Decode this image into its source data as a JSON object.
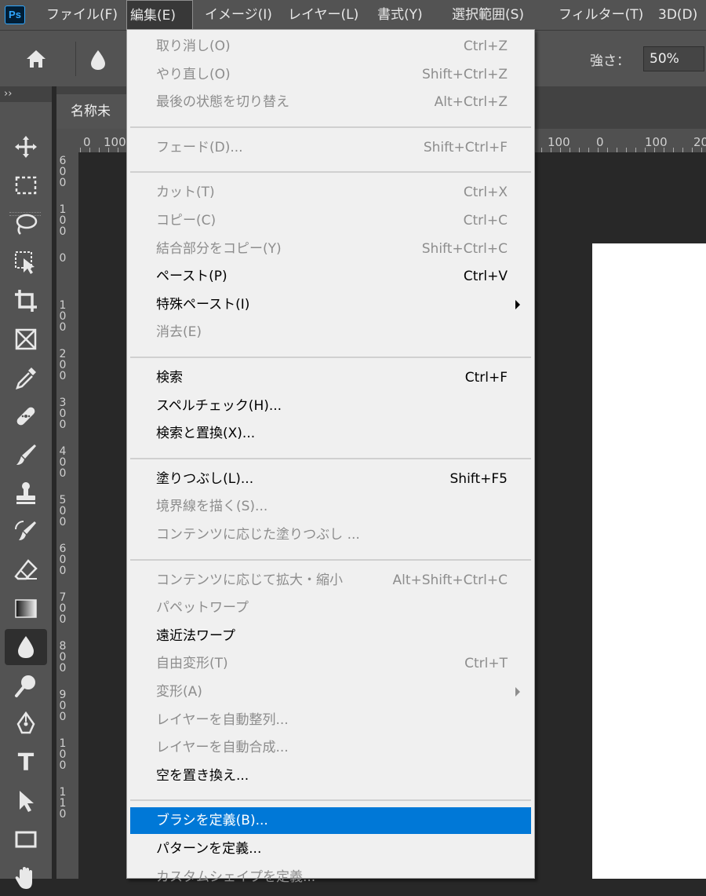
{
  "app": {
    "logo": "Ps"
  },
  "menubar": {
    "items": [
      {
        "label": "ファイル(F)",
        "active": false
      },
      {
        "label": "編集(E)",
        "active": true
      },
      {
        "label": "イメージ(I)",
        "active": false
      },
      {
        "label": "レイヤー(L)",
        "active": false
      },
      {
        "label": "書式(Y)",
        "active": false
      },
      {
        "label": "選択範囲(S)",
        "active": false
      },
      {
        "label": "フィルター(T)",
        "active": false
      },
      {
        "label": "3D(D)",
        "active": false
      }
    ]
  },
  "options": {
    "strength_label": "強さ：",
    "strength_value": "50%"
  },
  "panel_collapse": "››",
  "document": {
    "tab_title": "名称未",
    "ruler_h_labels": [
      "0",
      "100",
      "100",
      "0",
      "100",
      "20"
    ],
    "ruler_v_groups": [
      [
        "6",
        "0",
        "0"
      ],
      [
        "1",
        "0",
        "0"
      ],
      [
        "0"
      ],
      [
        "1",
        "0",
        "0"
      ],
      [
        "2",
        "0",
        "0"
      ],
      [
        "3",
        "0",
        "0"
      ],
      [
        "4",
        "0",
        "0"
      ],
      [
        "5",
        "0",
        "0"
      ],
      [
        "6",
        "0",
        "0"
      ],
      [
        "7",
        "0",
        "0"
      ],
      [
        "8",
        "0",
        "0"
      ],
      [
        "9",
        "0",
        "0"
      ],
      [
        "1",
        "0",
        "0"
      ],
      [
        "1",
        "1",
        "0"
      ]
    ]
  },
  "tools": [
    {
      "name": "move-tool-icon"
    },
    {
      "name": "marquee-tool-icon"
    },
    {
      "name": "lasso-tool-icon"
    },
    {
      "name": "object-select-tool-icon"
    },
    {
      "name": "crop-tool-icon"
    },
    {
      "name": "frame-tool-icon"
    },
    {
      "name": "eyedropper-tool-icon"
    },
    {
      "name": "healing-brush-tool-icon"
    },
    {
      "name": "brush-tool-icon"
    },
    {
      "name": "clone-stamp-tool-icon"
    },
    {
      "name": "history-brush-tool-icon"
    },
    {
      "name": "eraser-tool-icon"
    },
    {
      "name": "gradient-tool-icon"
    },
    {
      "name": "blur-tool-icon",
      "selected": true
    },
    {
      "name": "dodge-tool-icon"
    },
    {
      "name": "pen-tool-icon"
    },
    {
      "name": "type-tool-icon",
      "glyph": "T"
    },
    {
      "name": "path-select-tool-icon"
    },
    {
      "name": "rectangle-tool-icon"
    },
    {
      "name": "hand-tool-icon"
    }
  ],
  "edit_menu": {
    "items": [
      {
        "type": "item",
        "label": "取り消し(O)",
        "shortcut": "Ctrl+Z",
        "enabled": false
      },
      {
        "type": "item",
        "label": "やり直し(O)",
        "shortcut": "Shift+Ctrl+Z",
        "enabled": false
      },
      {
        "type": "item",
        "label": "最後の状態を切り替え",
        "shortcut": "Alt+Ctrl+Z",
        "enabled": false
      },
      {
        "type": "separator"
      },
      {
        "type": "item",
        "label": "フェード(D)...",
        "shortcut": "Shift+Ctrl+F",
        "enabled": false
      },
      {
        "type": "separator"
      },
      {
        "type": "item",
        "label": "カット(T)",
        "shortcut": "Ctrl+X",
        "enabled": false
      },
      {
        "type": "item",
        "label": "コピー(C)",
        "shortcut": "Ctrl+C",
        "enabled": false
      },
      {
        "type": "item",
        "label": "結合部分をコピー(Y)",
        "shortcut": "Shift+Ctrl+C",
        "enabled": false
      },
      {
        "type": "item",
        "label": "ペースト(P)",
        "shortcut": "Ctrl+V",
        "enabled": true
      },
      {
        "type": "item",
        "label": "特殊ペースト(I)",
        "shortcut": "",
        "enabled": true,
        "submenu": true
      },
      {
        "type": "item",
        "label": "消去(E)",
        "shortcut": "",
        "enabled": false
      },
      {
        "type": "separator"
      },
      {
        "type": "item",
        "label": "検索",
        "shortcut": "Ctrl+F",
        "enabled": true
      },
      {
        "type": "item",
        "label": "スペルチェック(H)...",
        "shortcut": "",
        "enabled": true
      },
      {
        "type": "item",
        "label": "検索と置換(X)...",
        "shortcut": "",
        "enabled": true
      },
      {
        "type": "separator"
      },
      {
        "type": "item",
        "label": "塗りつぶし(L)...",
        "shortcut": "Shift+F5",
        "enabled": true
      },
      {
        "type": "item",
        "label": "境界線を描く(S)...",
        "shortcut": "",
        "enabled": false
      },
      {
        "type": "item",
        "label": "コンテンツに応じた塗りつぶし ...",
        "shortcut": "",
        "enabled": false
      },
      {
        "type": "separator"
      },
      {
        "type": "item",
        "label": "コンテンツに応じて拡大・縮小",
        "shortcut": "Alt+Shift+Ctrl+C",
        "enabled": false
      },
      {
        "type": "item",
        "label": "パペットワープ",
        "shortcut": "",
        "enabled": false
      },
      {
        "type": "item",
        "label": "遠近法ワープ",
        "shortcut": "",
        "enabled": true
      },
      {
        "type": "item",
        "label": "自由変形(T)",
        "shortcut": "Ctrl+T",
        "enabled": false
      },
      {
        "type": "item",
        "label": "変形(A)",
        "shortcut": "",
        "enabled": false,
        "submenu": true
      },
      {
        "type": "item",
        "label": "レイヤーを自動整列...",
        "shortcut": "",
        "enabled": false
      },
      {
        "type": "item",
        "label": "レイヤーを自動合成...",
        "shortcut": "",
        "enabled": false
      },
      {
        "type": "item",
        "label": "空を置き換え...",
        "shortcut": "",
        "enabled": true
      },
      {
        "type": "separator"
      },
      {
        "type": "item",
        "label": "ブラシを定義(B)...",
        "shortcut": "",
        "enabled": true,
        "highlighted": true
      },
      {
        "type": "item",
        "label": "パターンを定義...",
        "shortcut": "",
        "enabled": true
      },
      {
        "type": "item",
        "label": "カスタムシェイプを定義...",
        "shortcut": "",
        "enabled": false
      }
    ]
  }
}
